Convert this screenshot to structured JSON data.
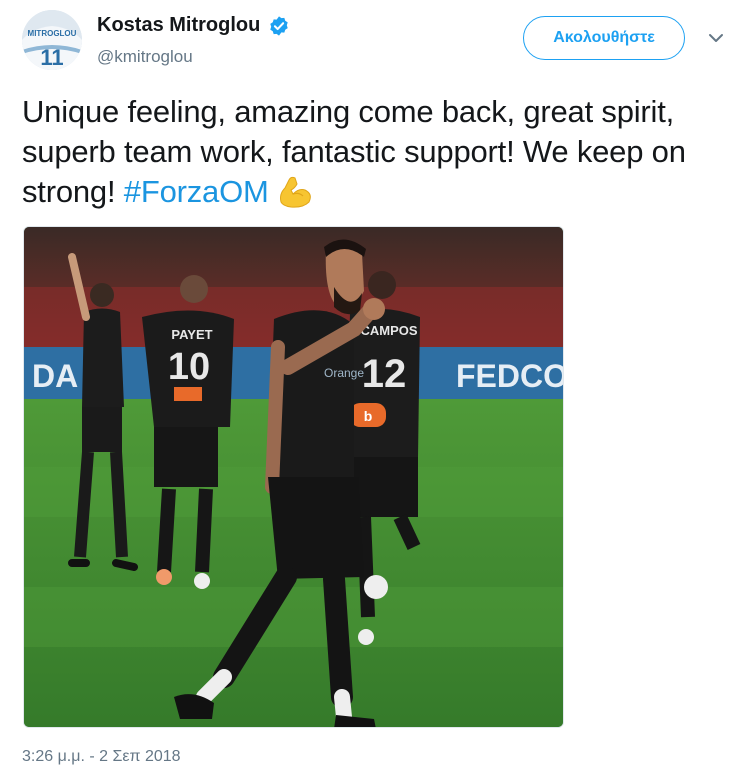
{
  "author": {
    "display_name": "Kostas Mitroglou",
    "handle": "@kmitroglou",
    "verified": true,
    "avatar_jersey_name": "MITROGLOU",
    "avatar_jersey_number": "11"
  },
  "actions": {
    "follow_label": "Ακολουθήστε",
    "menu_icon": "chevron-down-icon"
  },
  "tweet": {
    "text_before_hashtag": "Unique feeling, amazing come back, great spirit, superb team work, fantastic support! We keep on strong!",
    "hashtag": "#ForzaOM",
    "emoji": "flexed-biceps-emoji",
    "timestamp": "3:26 μ.μ. - 2 Σεπ 2018"
  },
  "media": {
    "description_icon": "photo",
    "jersey_numbers": [
      "10",
      "12"
    ],
    "jersey_names": [
      "PAYET",
      "OCAMPOS"
    ],
    "board_text": "FEDCO",
    "board_text_left": "DA",
    "sponsor_text": "Orange"
  },
  "colors": {
    "link": "#1b95e0",
    "follow": "#1da1f2",
    "verified": "#1da1f2",
    "muted": "#657786",
    "pitch": "#3f8a2f"
  }
}
